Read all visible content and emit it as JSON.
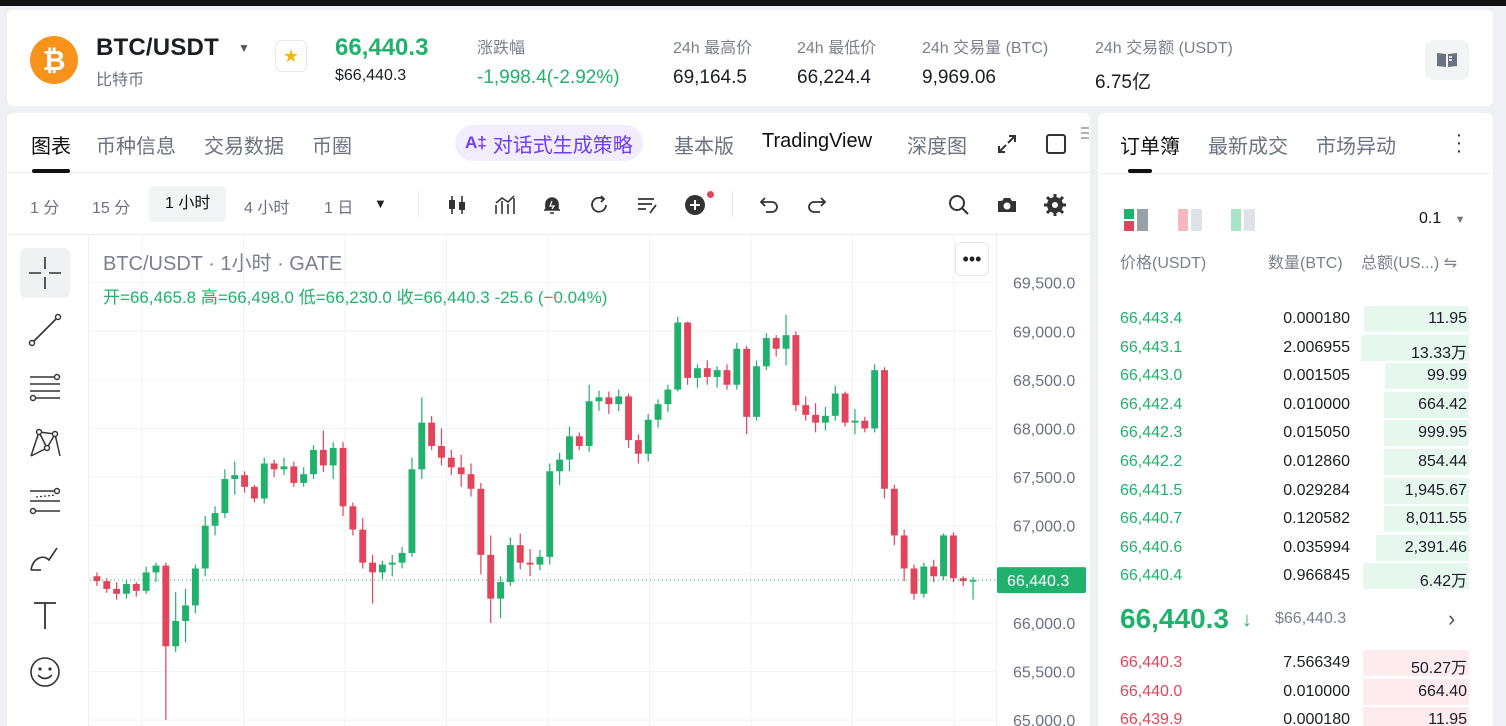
{
  "header": {
    "coin_symbol": "₿",
    "pair": "BTC/USDT",
    "coin_name": "比特币",
    "last_price": "66,440.3",
    "last_price_usd": "$66,440.3",
    "stats": [
      {
        "label": "涨跌幅",
        "value": "-1,998.4(-2.92%)",
        "color": "green"
      },
      {
        "label": "24h 最高价",
        "value": "69,164.5"
      },
      {
        "label": "24h 最低价",
        "value": "66,224.4"
      },
      {
        "label": "24h 交易量 (BTC)",
        "value": "9,969.06"
      },
      {
        "label": "24h 交易额 (USDT)",
        "value": "6.75亿"
      }
    ]
  },
  "chart_tabs": {
    "items": [
      "图表",
      "币种信息",
      "交易数据",
      "币圈"
    ],
    "ai_label": "对话式生成策略",
    "ai_icon_text": "A‡",
    "views": [
      "基本版",
      "TradingView",
      "深度图"
    ]
  },
  "toolbar": {
    "timeframes": [
      "1 分",
      "15 分",
      "1 小时",
      "4 小时",
      "1 日"
    ],
    "active_timeframe": "1 小时"
  },
  "legend": {
    "title": "BTC/USDT · 1小时 · GATE",
    "open_label": "开=",
    "open": "66,465.8",
    "high_label": "高=",
    "high": "66,498.0",
    "low_label": "低=",
    "low": "66,230.0",
    "close_label": "收=",
    "close": "66,440.3",
    "change": "-25.6 (−0.04%)"
  },
  "chart_data": {
    "type": "candlestick",
    "y_ticks": [
      "69,500.0",
      "69,000.0",
      "68,500.0",
      "68,000.0",
      "67,500.0",
      "67,000.0",
      "66,500.0",
      "66,000.0",
      "65,500.0",
      "65,000.0"
    ],
    "ylim": [
      64940,
      69990
    ],
    "current_price_label": "66,440.3",
    "current_price": 66440.3,
    "candles": [
      [
        66480,
        66520,
        66380,
        66430
      ],
      [
        66430,
        66460,
        66310,
        66350
      ],
      [
        66350,
        66420,
        66240,
        66300
      ],
      [
        66300,
        66440,
        66250,
        66400
      ],
      [
        66400,
        66420,
        66270,
        66330
      ],
      [
        66330,
        66580,
        66300,
        66520
      ],
      [
        66520,
        66620,
        66420,
        66590
      ],
      [
        66590,
        66620,
        65000,
        65760
      ],
      [
        65760,
        66320,
        65700,
        66020
      ],
      [
        66020,
        66350,
        65800,
        66180
      ],
      [
        66180,
        66600,
        66100,
        66560
      ],
      [
        66560,
        67100,
        66480,
        67000
      ],
      [
        67000,
        67200,
        66900,
        67130
      ],
      [
        67130,
        67580,
        67080,
        67480
      ],
      [
        67480,
        67660,
        67320,
        67520
      ],
      [
        67520,
        67560,
        67340,
        67400
      ],
      [
        67400,
        67420,
        67240,
        67280
      ],
      [
        67280,
        67700,
        67230,
        67640
      ],
      [
        67640,
        67680,
        67500,
        67580
      ],
      [
        67580,
        67700,
        67520,
        67610
      ],
      [
        67610,
        67660,
        67400,
        67440
      ],
      [
        67440,
        67600,
        67400,
        67530
      ],
      [
        67530,
        67830,
        67480,
        67780
      ],
      [
        67780,
        67980,
        67550,
        67620
      ],
      [
        67620,
        67860,
        67480,
        67800
      ],
      [
        67800,
        67860,
        67100,
        67200
      ],
      [
        67200,
        67240,
        66900,
        66960
      ],
      [
        66960,
        67080,
        66560,
        66620
      ],
      [
        66620,
        66700,
        66200,
        66520
      ],
      [
        66520,
        66640,
        66450,
        66600
      ],
      [
        66600,
        66700,
        66480,
        66620
      ],
      [
        66620,
        66780,
        66560,
        66720
      ],
      [
        66720,
        67700,
        66680,
        67580
      ],
      [
        67580,
        68320,
        67480,
        68060
      ],
      [
        68060,
        68130,
        67780,
        67820
      ],
      [
        67820,
        68000,
        67620,
        67700
      ],
      [
        67700,
        67780,
        67520,
        67600
      ],
      [
        67600,
        67730,
        67400,
        67530
      ],
      [
        67530,
        67640,
        67300,
        67380
      ],
      [
        67380,
        67440,
        66500,
        66700
      ],
      [
        66700,
        66900,
        66000,
        66250
      ],
      [
        66250,
        66480,
        66050,
        66420
      ],
      [
        66420,
        66880,
        66380,
        66800
      ],
      [
        66800,
        66920,
        66550,
        66620
      ],
      [
        66620,
        66760,
        66480,
        66600
      ],
      [
        66600,
        66750,
        66540,
        66680
      ],
      [
        66680,
        67640,
        66600,
        67560
      ],
      [
        67560,
        67750,
        67420,
        67680
      ],
      [
        67680,
        68020,
        67560,
        67920
      ],
      [
        67920,
        67960,
        67780,
        67820
      ],
      [
        67820,
        68450,
        67760,
        68280
      ],
      [
        68280,
        68390,
        68180,
        68320
      ],
      [
        68320,
        68380,
        68150,
        68250
      ],
      [
        68250,
        68400,
        68180,
        68330
      ],
      [
        68330,
        68360,
        67800,
        67880
      ],
      [
        67880,
        67940,
        67640,
        67740
      ],
      [
        67740,
        68150,
        67660,
        68090
      ],
      [
        68090,
        68300,
        68010,
        68250
      ],
      [
        68250,
        68450,
        68170,
        68400
      ],
      [
        68400,
        69150,
        68380,
        69090
      ],
      [
        69090,
        69100,
        68450,
        68520
      ],
      [
        68520,
        68660,
        68420,
        68620
      ],
      [
        68620,
        68700,
        68450,
        68530
      ],
      [
        68530,
        68640,
        68420,
        68600
      ],
      [
        68600,
        68660,
        68400,
        68450
      ],
      [
        68450,
        68880,
        68400,
        68820
      ],
      [
        68820,
        68850,
        67940,
        68120
      ],
      [
        68120,
        68700,
        68080,
        68640
      ],
      [
        68640,
        68980,
        68600,
        68930
      ],
      [
        68930,
        68960,
        68740,
        68820
      ],
      [
        68820,
        69170,
        68650,
        68960
      ],
      [
        68960,
        69000,
        68180,
        68240
      ],
      [
        68240,
        68330,
        68080,
        68140
      ],
      [
        68140,
        68260,
        67960,
        68060
      ],
      [
        68060,
        68220,
        67980,
        68130
      ],
      [
        68130,
        68440,
        68080,
        68360
      ],
      [
        68360,
        68380,
        68020,
        68060
      ],
      [
        68060,
        68200,
        67940,
        68080
      ],
      [
        68080,
        68120,
        67960,
        68000
      ],
      [
        68000,
        68660,
        67960,
        68600
      ],
      [
        68600,
        68630,
        67280,
        67380
      ],
      [
        67380,
        67420,
        66800,
        66900
      ],
      [
        66900,
        66960,
        66430,
        66560
      ],
      [
        66560,
        66600,
        66240,
        66300
      ],
      [
        66300,
        66620,
        66260,
        66580
      ],
      [
        66580,
        66650,
        66420,
        66480
      ],
      [
        66480,
        66920,
        66440,
        66900
      ],
      [
        66900,
        66930,
        66420,
        66460
      ],
      [
        66460,
        66480,
        66380,
        66430
      ],
      [
        66430,
        66470,
        66240,
        66440
      ]
    ]
  },
  "book": {
    "tabs": [
      "订单簿",
      "最新成交",
      "市场异动"
    ],
    "precision": "0.1",
    "col_price": "价格(USDT)",
    "col_qty": "数量(BTC)",
    "col_total": "总额(US...)",
    "col_total_suffix": "⇋",
    "asks": [
      {
        "p": "66,443.4",
        "q": "0.000180",
        "t": "11.95",
        "d": 0.7
      },
      {
        "p": "66,443.1",
        "q": "2.006955",
        "t": "13.33万",
        "d": 0.72
      },
      {
        "p": "66,443.0",
        "q": "0.001505",
        "t": "99.99",
        "d": 0.56
      },
      {
        "p": "66,442.4",
        "q": "0.010000",
        "t": "664.42",
        "d": 0.57
      },
      {
        "p": "66,442.3",
        "q": "0.015050",
        "t": "999.95",
        "d": 0.57
      },
      {
        "p": "66,442.2",
        "q": "0.012860",
        "t": "854.44",
        "d": 0.57
      },
      {
        "p": "66,441.5",
        "q": "0.029284",
        "t": "1,945.67",
        "d": 0.57
      },
      {
        "p": "66,440.7",
        "q": "0.120582",
        "t": "8,011.55",
        "d": 0.57
      },
      {
        "p": "66,440.6",
        "q": "0.035994",
        "t": "2,391.46",
        "d": 0.62
      },
      {
        "p": "66,440.4",
        "q": "0.966845",
        "t": "6.42万",
        "d": 0.71
      }
    ],
    "mid_price": "66,440.3",
    "mid_arrow": "↓",
    "mid_price_usd": "$66,440.3",
    "mid_chevron": "›",
    "bids": [
      {
        "p": "66,440.3",
        "q": "7.566349",
        "t": "50.27万",
        "d": 0.71
      },
      {
        "p": "66,440.0",
        "q": "0.010000",
        "t": "664.40",
        "d": 0.71
      },
      {
        "p": "66,439.9",
        "q": "0.000180",
        "t": "11.95",
        "d": 0.71
      }
    ]
  },
  "colors": {
    "up": "#20b26c",
    "down": "#e2445c",
    "accent": "#6d3cf5",
    "brand": "#f7931a"
  },
  "icons": [
    "bitcoin-logo-icon",
    "star-icon",
    "book-icon",
    "ai-icon",
    "expand-icon",
    "square-icon",
    "candle-type-icon",
    "indicator-icon",
    "alert-icon",
    "replay-icon",
    "drawing-list-icon",
    "add-indicator-icon",
    "undo-icon",
    "redo-icon",
    "search-icon",
    "camera-icon",
    "settings-icon",
    "crosshair-icon",
    "trend-line-icon",
    "fib-icon",
    "pattern-icon",
    "measure-icon",
    "brush-icon",
    "text-icon",
    "emoji-icon",
    "more-icon",
    "chevron-right-icon"
  ]
}
